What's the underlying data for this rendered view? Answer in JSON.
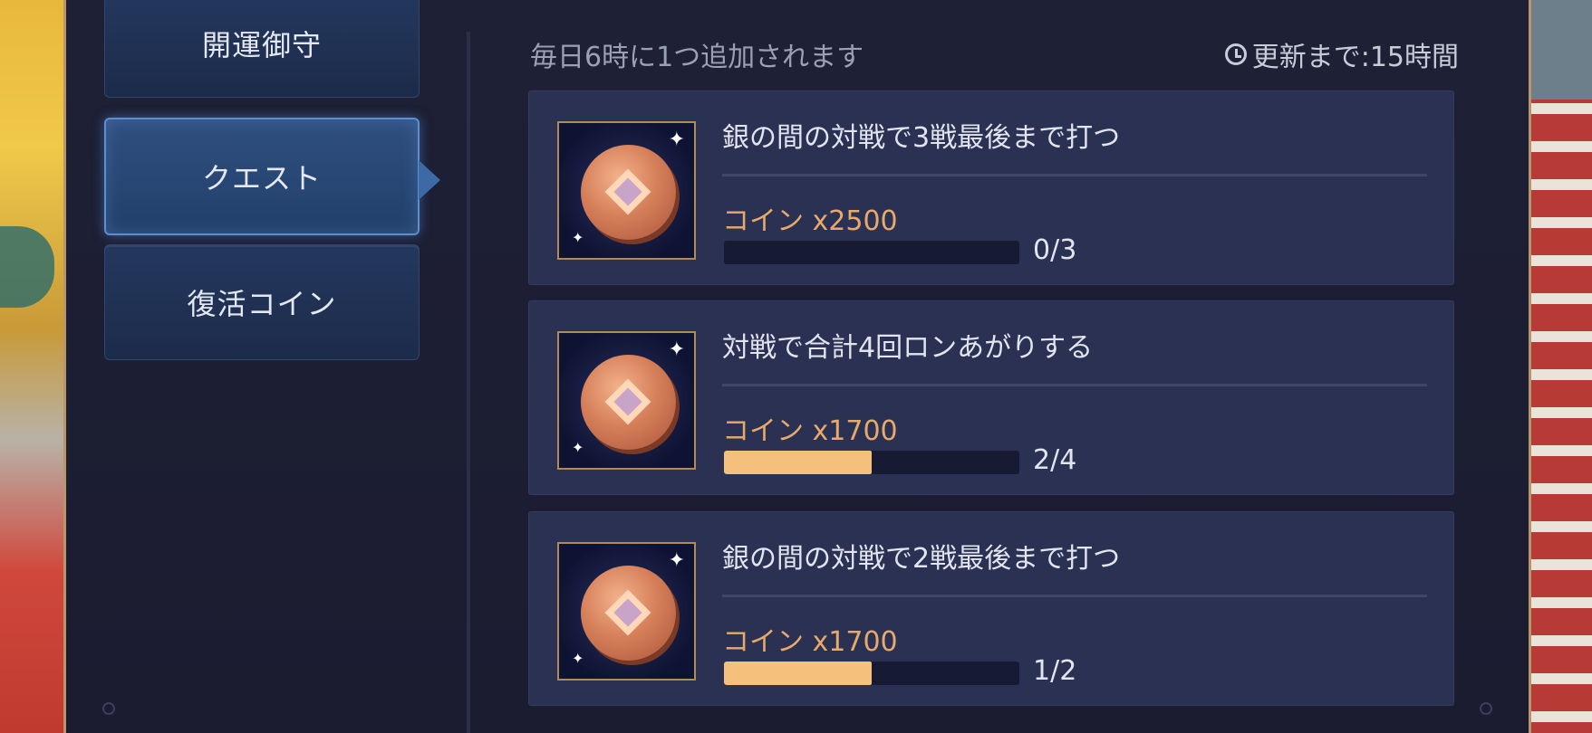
{
  "nav": {
    "items": [
      {
        "label": "開運御守",
        "active": false
      },
      {
        "label": "クエスト",
        "active": true
      },
      {
        "label": "復活コイン",
        "active": false
      }
    ]
  },
  "header": {
    "info": "毎日6時に1つ追加されます",
    "timer": "更新まで:15時間",
    "timer_icon": "clock-icon"
  },
  "quests": [
    {
      "title": "銀の間の対戦で3戦最後まで打つ",
      "reward": "コイン x2500",
      "progress_text": "0/3",
      "progress": 0.0,
      "icon": "coin-icon"
    },
    {
      "title": "対戦で合計4回ロンあがりする",
      "reward": "コイン x1700",
      "progress_text": "2/4",
      "progress": 0.5,
      "icon": "coin-icon"
    },
    {
      "title": "銀の間の対戦で2戦最後まで打つ",
      "reward": "コイン x1700",
      "progress_text": "1/2",
      "progress": 0.5,
      "icon": "coin-icon"
    }
  ],
  "colors": {
    "accent_reward": "#e7aa6c",
    "progress_fill": "#f4c07c",
    "active_border": "#5b8fcf"
  }
}
